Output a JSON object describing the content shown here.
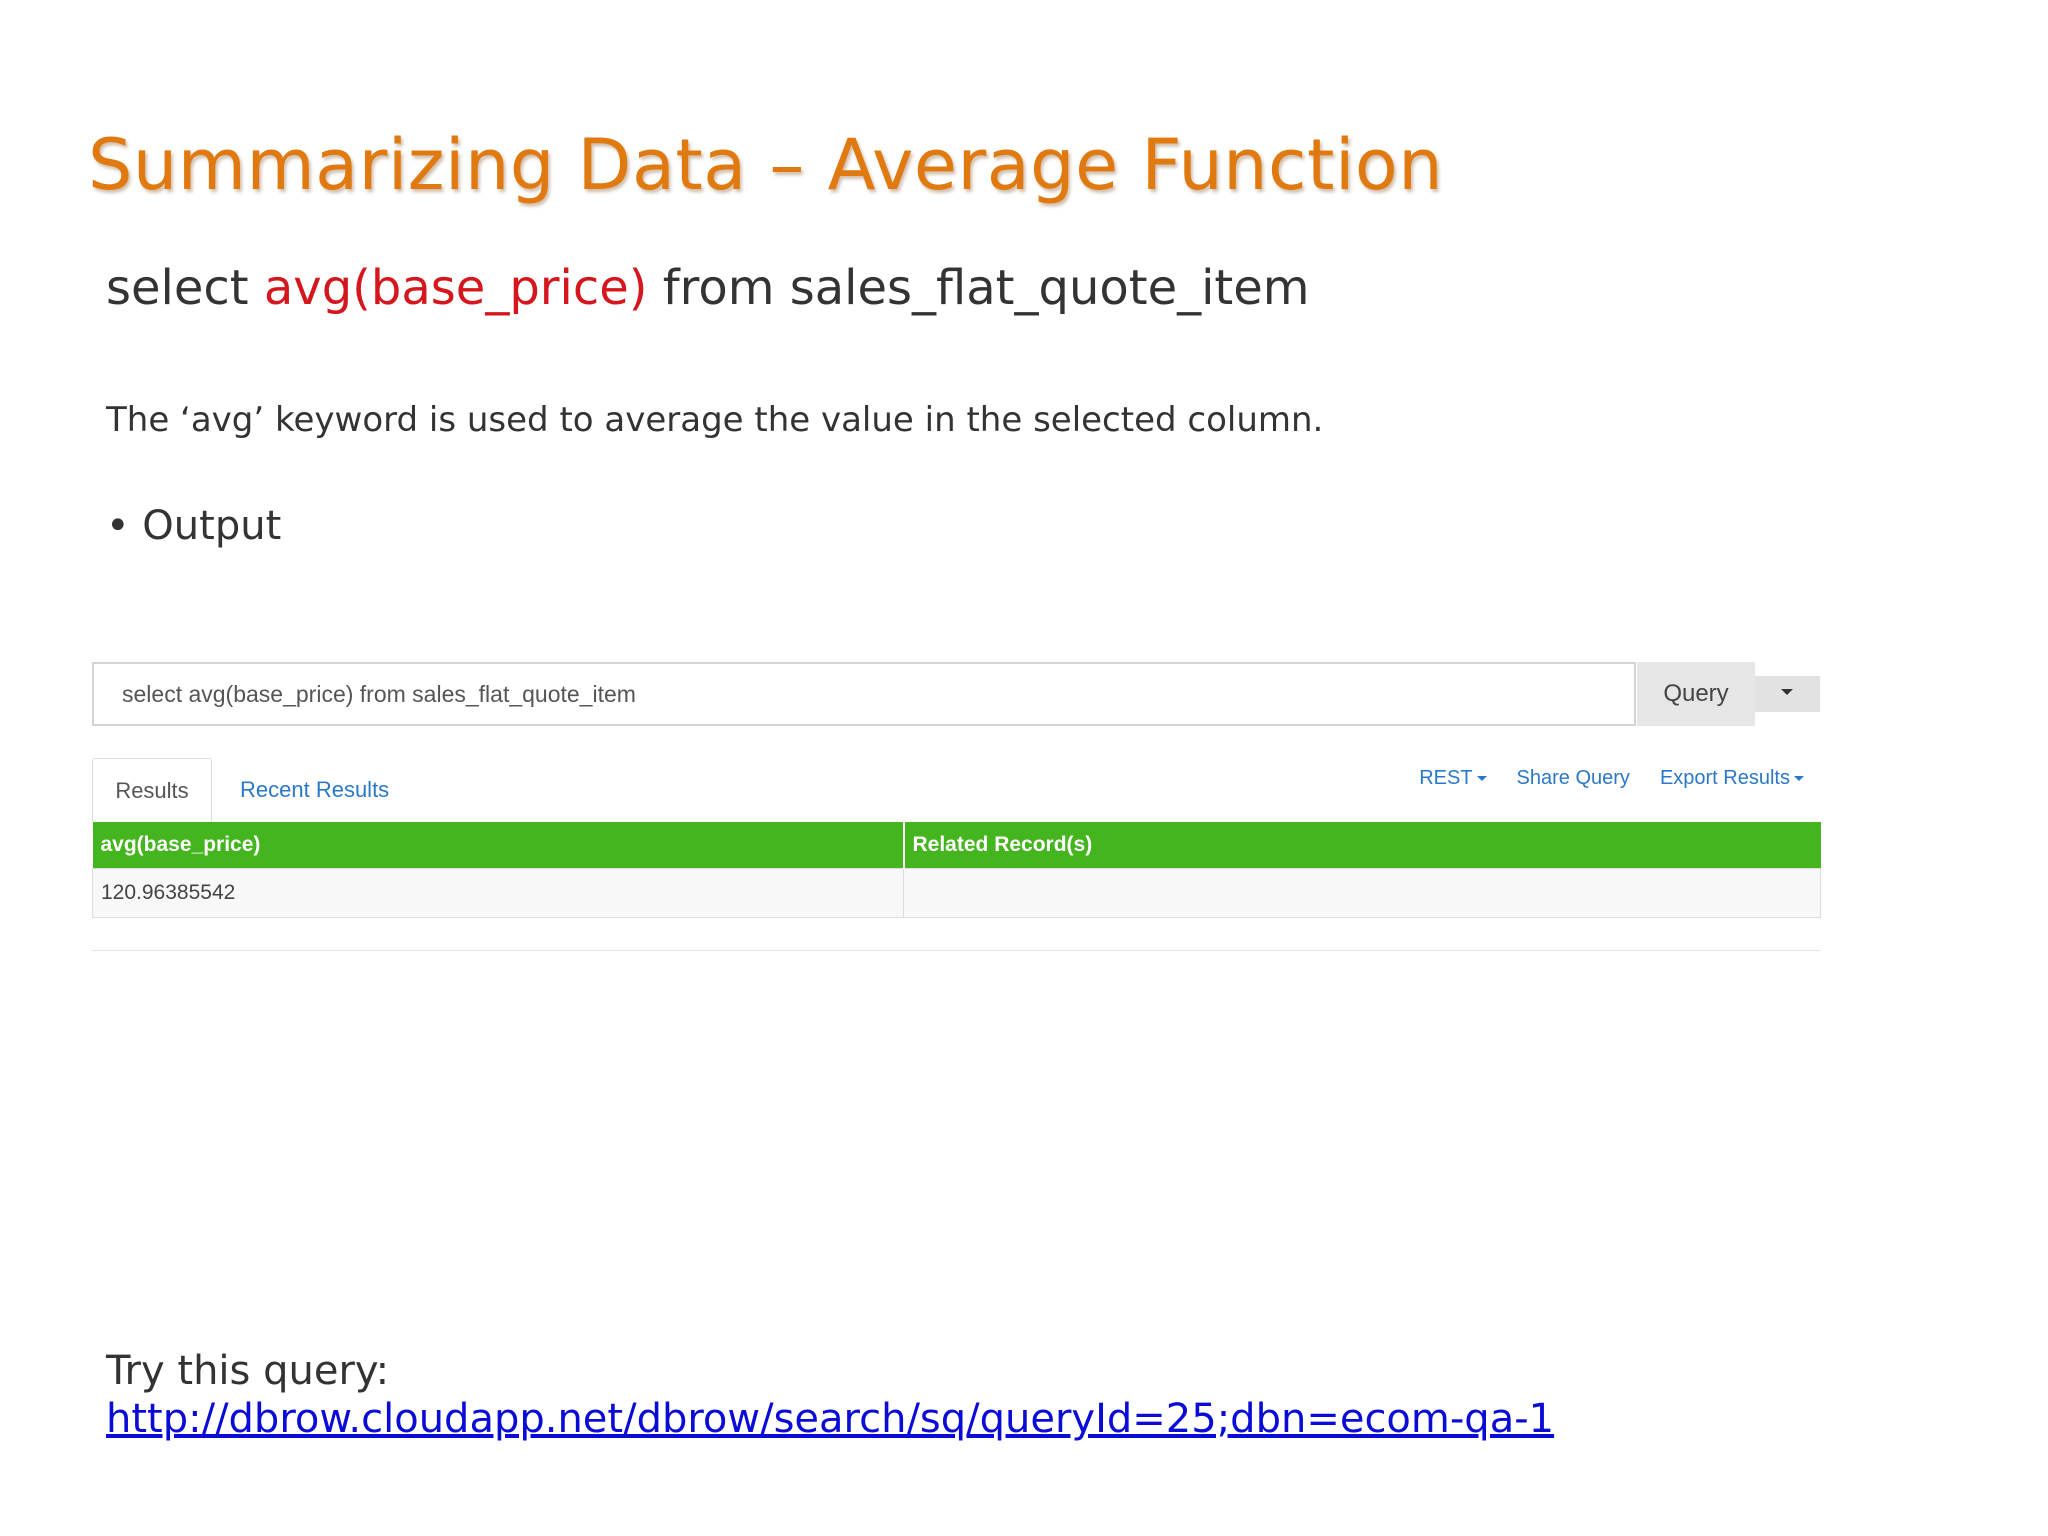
{
  "slide": {
    "title": "Summarizing Data – Average Function",
    "sql": {
      "prefix": "select ",
      "function": "avg(base_price)",
      "suffix": " from sales_flat_quote_item"
    },
    "description": "The ‘avg’ keyword is used to average the value in the selected column.",
    "bullet": "• Output",
    "try_label": "Try this query:",
    "try_link": "http://dbrow.cloudapp.net/dbrow/search/sq/queryId=25;dbn=ecom-qa-1"
  },
  "app": {
    "query_value": "select avg(base_price) from sales_flat_quote_item",
    "query_button": "Query",
    "tabs": [
      "Results",
      "Recent Results"
    ],
    "actions": {
      "rest": "REST",
      "share": "Share Query",
      "export": "Export Results"
    },
    "table": {
      "columns": [
        "avg(base_price)",
        "Related Record(s)"
      ],
      "rows": [
        [
          "120.96385542",
          ""
        ]
      ]
    }
  },
  "colors": {
    "title": "#e07a10",
    "sql_function": "#d6161d",
    "table_header": "#44b51f",
    "link": "#2a78c8",
    "slide_link": "#0b0bd8"
  }
}
